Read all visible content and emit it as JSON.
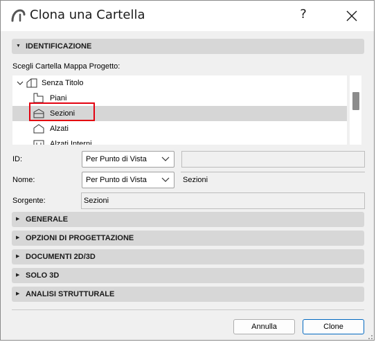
{
  "window": {
    "title": "Clona una Cartella",
    "help": "?"
  },
  "sections": {
    "identificazione": "IDENTIFICAZIONE",
    "generale": "GENERALE",
    "opzioni": "OPZIONI DI PROGETTAZIONE",
    "documenti": "DOCUMENTI 2D/3D",
    "solo3d": "SOLO 3D",
    "analisi": "ANALISI STRUTTURALE"
  },
  "tree": {
    "caption": "Scegli Cartella Mappa Progetto:",
    "items": [
      {
        "label": "Senza Titolo",
        "icon": "building-icon"
      },
      {
        "label": "Piani",
        "icon": "floor-plan-icon"
      },
      {
        "label": "Sezioni",
        "icon": "section-icon",
        "selected": true
      },
      {
        "label": "Alzati",
        "icon": "elevation-icon"
      },
      {
        "label": "Alzati Interni",
        "icon": "interior-elevation-icon"
      }
    ]
  },
  "fields": {
    "id": {
      "label": "ID:",
      "mode": "Per Punto di Vista",
      "value": ""
    },
    "nome": {
      "label": "Nome:",
      "mode": "Per Punto di Vista",
      "value": "Sezioni"
    },
    "sorgente": {
      "label": "Sorgente:",
      "value": "Sezioni"
    }
  },
  "buttons": {
    "cancel": "Annulla",
    "ok": "Clone"
  },
  "colors": {
    "highlight": "#e3000f",
    "accent": "#0067c0",
    "section_bar": "#d7d7d7"
  }
}
